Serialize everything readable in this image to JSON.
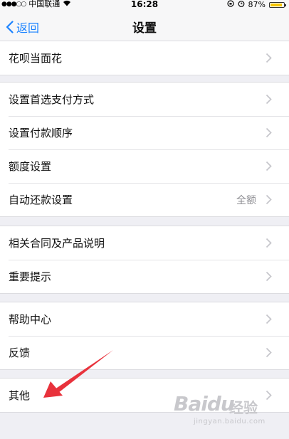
{
  "status_bar": {
    "signal": "●●●○○",
    "carrier": "中国联通",
    "time": "16:28",
    "battery_percent": "87%",
    "battery_level": 0.87
  },
  "nav": {
    "back_label": "返回",
    "title": "设置"
  },
  "groups": [
    {
      "items": [
        {
          "label": "花呗当面花"
        }
      ]
    },
    {
      "items": [
        {
          "label": "设置首选支付方式"
        },
        {
          "label": "设置付款顺序"
        },
        {
          "label": "额度设置"
        },
        {
          "label": "自动还款设置",
          "value": "全额"
        }
      ]
    },
    {
      "items": [
        {
          "label": "相关合同及产品说明"
        },
        {
          "label": "重要提示"
        }
      ]
    },
    {
      "items": [
        {
          "label": "帮助中心"
        },
        {
          "label": "反馈"
        }
      ]
    },
    {
      "items": [
        {
          "label": "其他"
        }
      ]
    }
  ],
  "watermark": {
    "brand": "Baidu",
    "sub": "经验",
    "url": "jingyan.baidu.com"
  },
  "colors": {
    "accent": "#1a82ff",
    "annotation_arrow": "#e8323c",
    "battery": "#f5c400"
  }
}
